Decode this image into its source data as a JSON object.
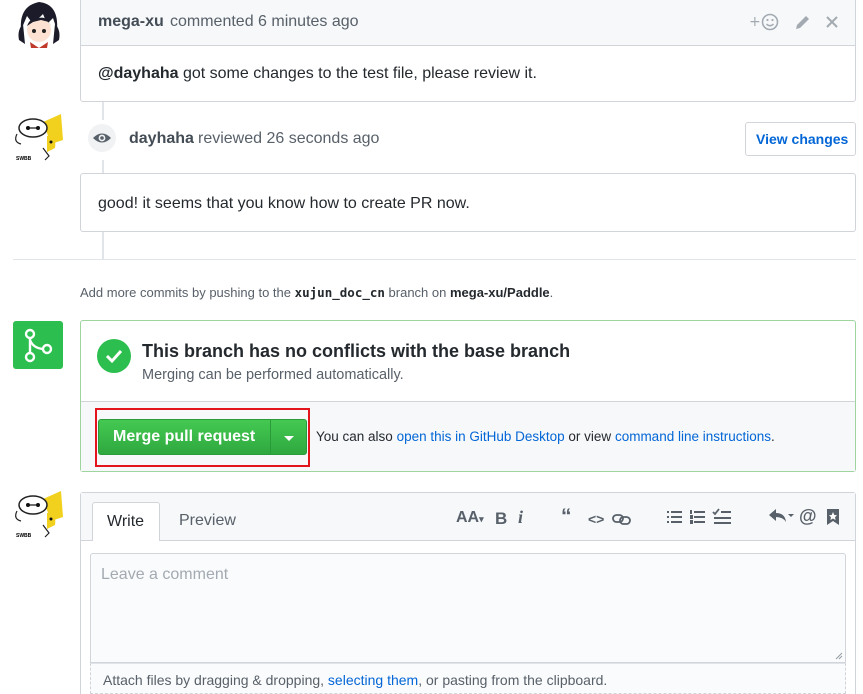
{
  "comment1": {
    "author": "mega-xu",
    "action": "commented 6 minutes ago",
    "mention": "@dayhaha",
    "body": " got some changes to the test file, please review it."
  },
  "review": {
    "author": "dayhaha",
    "action": "reviewed 26 seconds ago",
    "view_changes_label": "View changes",
    "body": "good! it seems that you know how to create PR now."
  },
  "push_hint": {
    "prefix": "Add more commits by pushing to the ",
    "branch": "xujun_doc_cn",
    "middle": " branch on ",
    "repo": "mega-xu/Paddle",
    "suffix": "."
  },
  "merge": {
    "title": "This branch has no conflicts with the base branch",
    "subtitle": "Merging can be performed automatically.",
    "button_label": "Merge pull request",
    "also_prefix": "You can also ",
    "desktop_link": "open this in GitHub Desktop",
    "or_view": " or view ",
    "cli_link": "command line instructions",
    "also_suffix": "."
  },
  "editor": {
    "tabs": [
      "Write",
      "Preview"
    ],
    "placeholder": "Leave a comment",
    "attach_prefix": "Attach files by dragging & dropping, ",
    "attach_link": "selecting them",
    "attach_suffix": ", or pasting from the clipboard."
  },
  "avatar_badge_text": "SWBB",
  "colors": {
    "green": "#2cbe4e",
    "link": "#0366d6",
    "highlight": "#e3141b"
  }
}
